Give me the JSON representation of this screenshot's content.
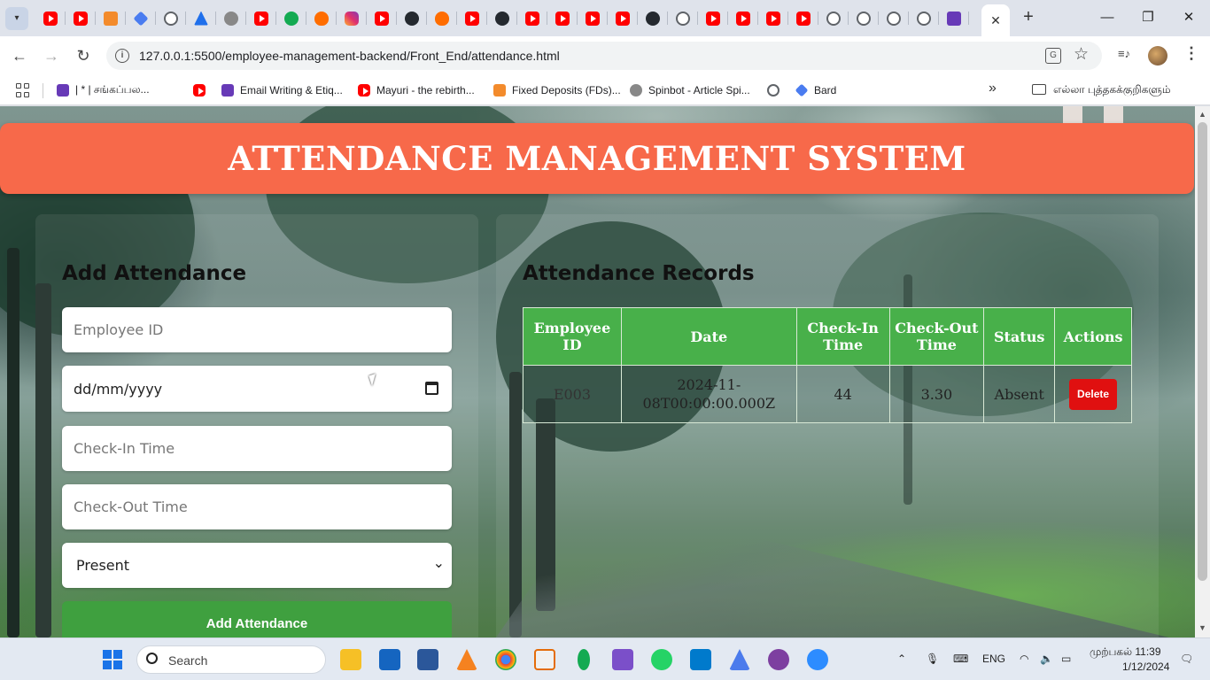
{
  "browser": {
    "tab_strip": {
      "favicons": [
        "yt",
        "yt",
        "sc",
        "diamond",
        "globe",
        "atl",
        "gray",
        "yt",
        "leaf",
        "flame",
        "ig",
        "yt",
        "gh",
        "flame",
        "yt",
        "gh",
        "yt",
        "yt",
        "yt",
        "yt",
        "gh",
        "globe",
        "yt",
        "yt",
        "yt",
        "yt",
        "globe",
        "globe",
        "globe",
        "globe",
        "form"
      ],
      "close_label": "✕",
      "new_tab_label": "+"
    },
    "window_controls": {
      "minimize": "—",
      "restore": "❐",
      "close": "✕"
    },
    "url": "127.0.0.1:5500/employee-management-backend/Front_End/attendance.html",
    "bookmarks": [
      {
        "label": "| * | சங்கப்பல...",
        "icon": "form"
      },
      {
        "label": "",
        "icon": "yt"
      },
      {
        "label": "Email Writing & Etiq...",
        "icon": "form"
      },
      {
        "label": "Mayuri - the rebirth...",
        "icon": "yt"
      },
      {
        "label": "Fixed Deposits (FDs)...",
        "icon": "sc"
      },
      {
        "label": "Spinbot - Article Spi...",
        "icon": "gray"
      },
      {
        "label": "",
        "icon": "globe"
      },
      {
        "label": "Bard",
        "icon": "diamond"
      }
    ],
    "bookmarks_more": "»",
    "all_bookmarks_label": "எல்லா புத்தகக்குறிகளும்"
  },
  "page": {
    "title": "ATTENDANCE MANAGEMENT SYSTEM",
    "form": {
      "heading": "Add Attendance",
      "employee_id_placeholder": "Employee ID",
      "date_placeholder": "dd/mm/yyyy",
      "checkin_placeholder": "Check-In Time",
      "checkout_placeholder": "Check-Out Time",
      "status_value": "Present",
      "submit_label": "Add Attendance"
    },
    "records": {
      "heading": "Attendance Records",
      "columns": [
        "Employee ID",
        "Date",
        "Check-In Time",
        "Check-Out Time",
        "Status",
        "Actions"
      ],
      "rows": [
        {
          "employee_id": "E003",
          "date": "2024-11-08T00:00:00.000Z",
          "check_in": "44",
          "check_out": "3.30",
          "status": "Absent",
          "action_label": "Delete"
        }
      ]
    }
  },
  "taskbar": {
    "search_label": "Search",
    "language": "ENG",
    "time": "முற்பகல் 11:39",
    "date": "1/12/2024"
  },
  "colors": {
    "banner": "#f7694a",
    "table_header": "#48b04a",
    "add_button": "#3fa03f",
    "delete_button": "#e01010"
  }
}
